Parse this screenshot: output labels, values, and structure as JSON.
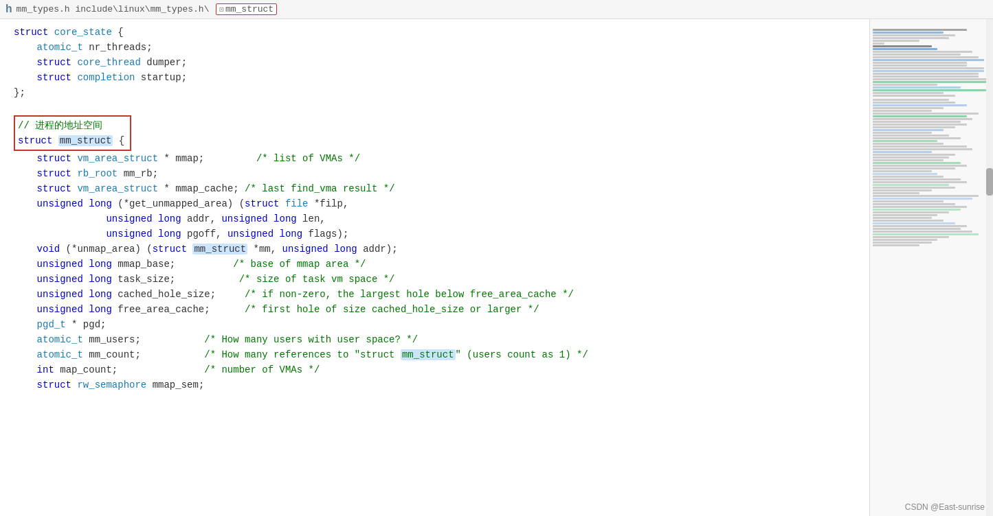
{
  "header": {
    "icon": "h",
    "breadcrumb_parts": [
      {
        "text": "mm_types.h",
        "active": false
      },
      {
        "text": " include\\linux\\mm_types.h\\",
        "active": false
      },
      {
        "text": "mm_struct",
        "active": true,
        "boxed": true
      }
    ]
  },
  "code": {
    "lines": [
      {
        "id": 1,
        "content": "struct core_state {",
        "type": "mixed"
      },
      {
        "id": 2,
        "content": "    atomic_t nr_threads;",
        "type": "mixed"
      },
      {
        "id": 3,
        "content": "    struct core_thread dumper;",
        "type": "mixed"
      },
      {
        "id": 4,
        "content": "    struct completion startup;",
        "type": "mixed"
      },
      {
        "id": 5,
        "content": "};",
        "type": "punct"
      },
      {
        "id": 6,
        "content": "",
        "type": "blank"
      },
      {
        "id": 7,
        "content": "// 进程的地址空间",
        "type": "comment",
        "boxed_start": true
      },
      {
        "id": 8,
        "content": "struct mm_struct {",
        "type": "mixed",
        "boxed_end": true,
        "highlight": "mm_struct"
      },
      {
        "id": 9,
        "content": "    struct vm_area_struct * mmap;         /* list of VMAs */",
        "type": "mixed"
      },
      {
        "id": 10,
        "content": "    struct rb_root mm_rb;",
        "type": "mixed"
      },
      {
        "id": 11,
        "content": "    struct vm_area_struct * mmap_cache; /* last find_vma result */",
        "type": "mixed"
      },
      {
        "id": 12,
        "content": "    unsigned long (*get_unmapped_area) (struct file *filp,",
        "type": "mixed"
      },
      {
        "id": 13,
        "content": "                unsigned long addr, unsigned long len,",
        "type": "mixed"
      },
      {
        "id": 14,
        "content": "                unsigned long pgoff, unsigned long flags);",
        "type": "mixed"
      },
      {
        "id": 15,
        "content": "    void (*unmap_area) (struct mm_struct *mm, unsigned long addr);",
        "type": "mixed",
        "highlight": "mm_struct"
      },
      {
        "id": 16,
        "content": "    unsigned long mmap_base;          /* base of mmap area */",
        "type": "mixed"
      },
      {
        "id": 17,
        "content": "    unsigned long task_size;           /* size of task vm space */",
        "type": "mixed"
      },
      {
        "id": 18,
        "content": "    unsigned long cached_hole_size;     /* if non-zero, the largest hole below free_area_cache */",
        "type": "mixed"
      },
      {
        "id": 19,
        "content": "    unsigned long free_area_cache;      /* first hole of size cached_hole_size or larger */",
        "type": "mixed"
      },
      {
        "id": 20,
        "content": "    pgd_t * pgd;",
        "type": "mixed"
      },
      {
        "id": 21,
        "content": "    atomic_t mm_users;           /* How many users with user space? */",
        "type": "mixed"
      },
      {
        "id": 22,
        "content": "    atomic_t mm_count;           /* How many references to \"struct mm_struct\" (users count as 1) */",
        "type": "mixed",
        "highlight2": "mm_struct"
      },
      {
        "id": 23,
        "content": "    int map_count;               /* number of VMAs */",
        "type": "mixed"
      },
      {
        "id": 24,
        "content": "    struct rw_semaphore mmap_sem;",
        "type": "mixed"
      }
    ]
  },
  "attribution": {
    "text": "CSDN @East-sunrise"
  },
  "colors": {
    "keyword": "#0000cc",
    "comment": "#007700",
    "highlight_bg": "#cce5ff",
    "red_border": "#c0392b",
    "type_color": "#0099cc"
  }
}
